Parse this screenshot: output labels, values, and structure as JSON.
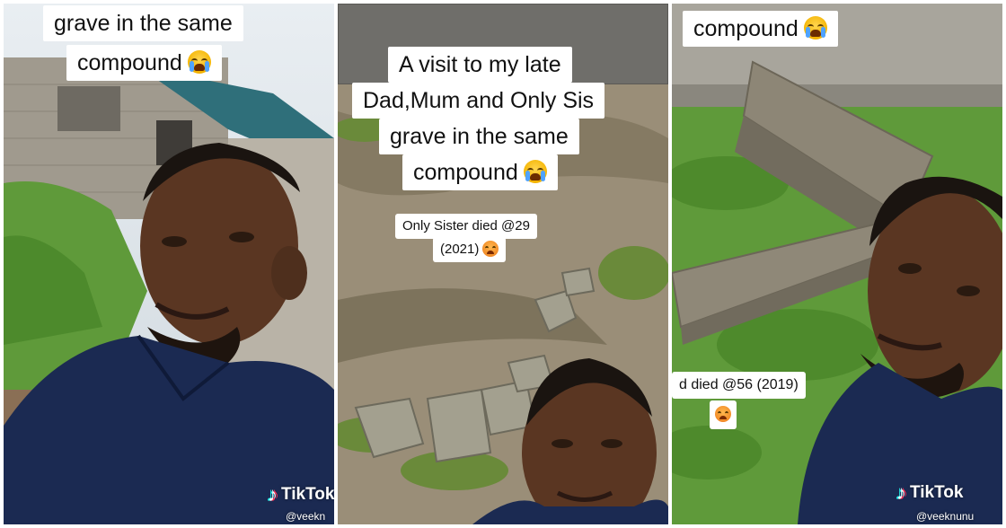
{
  "panels": [
    {
      "caption_lines": [
        "grave in the same",
        "compound"
      ],
      "watermark": {
        "brand": "TikTok",
        "handle": "@veekn"
      }
    },
    {
      "caption_lines": [
        "A visit to my late",
        "Dad,Mum and Only Sis",
        "grave in the same",
        "compound"
      ],
      "note_lines": [
        "Only Sister died @29",
        "(2021)"
      ],
      "watermark": {
        "brand": "",
        "handle": ""
      }
    },
    {
      "caption_lines": [
        "compound"
      ],
      "note_lines": [
        "d died @56 (2019)"
      ],
      "watermark": {
        "brand": "TikTok",
        "handle": "@veeknunu"
      }
    }
  ],
  "icons": {
    "caption_emoji": "loudly-crying-face-emoji-icon",
    "note_emoji": "worried-face-emoji-icon",
    "watermark_logo": "tiktok-note-icon"
  },
  "colors": {
    "caption_bg": "#ffffff",
    "shirt_navy": "#1b2a52",
    "grass": "#5f9a3a",
    "wall": "#9b958a"
  }
}
